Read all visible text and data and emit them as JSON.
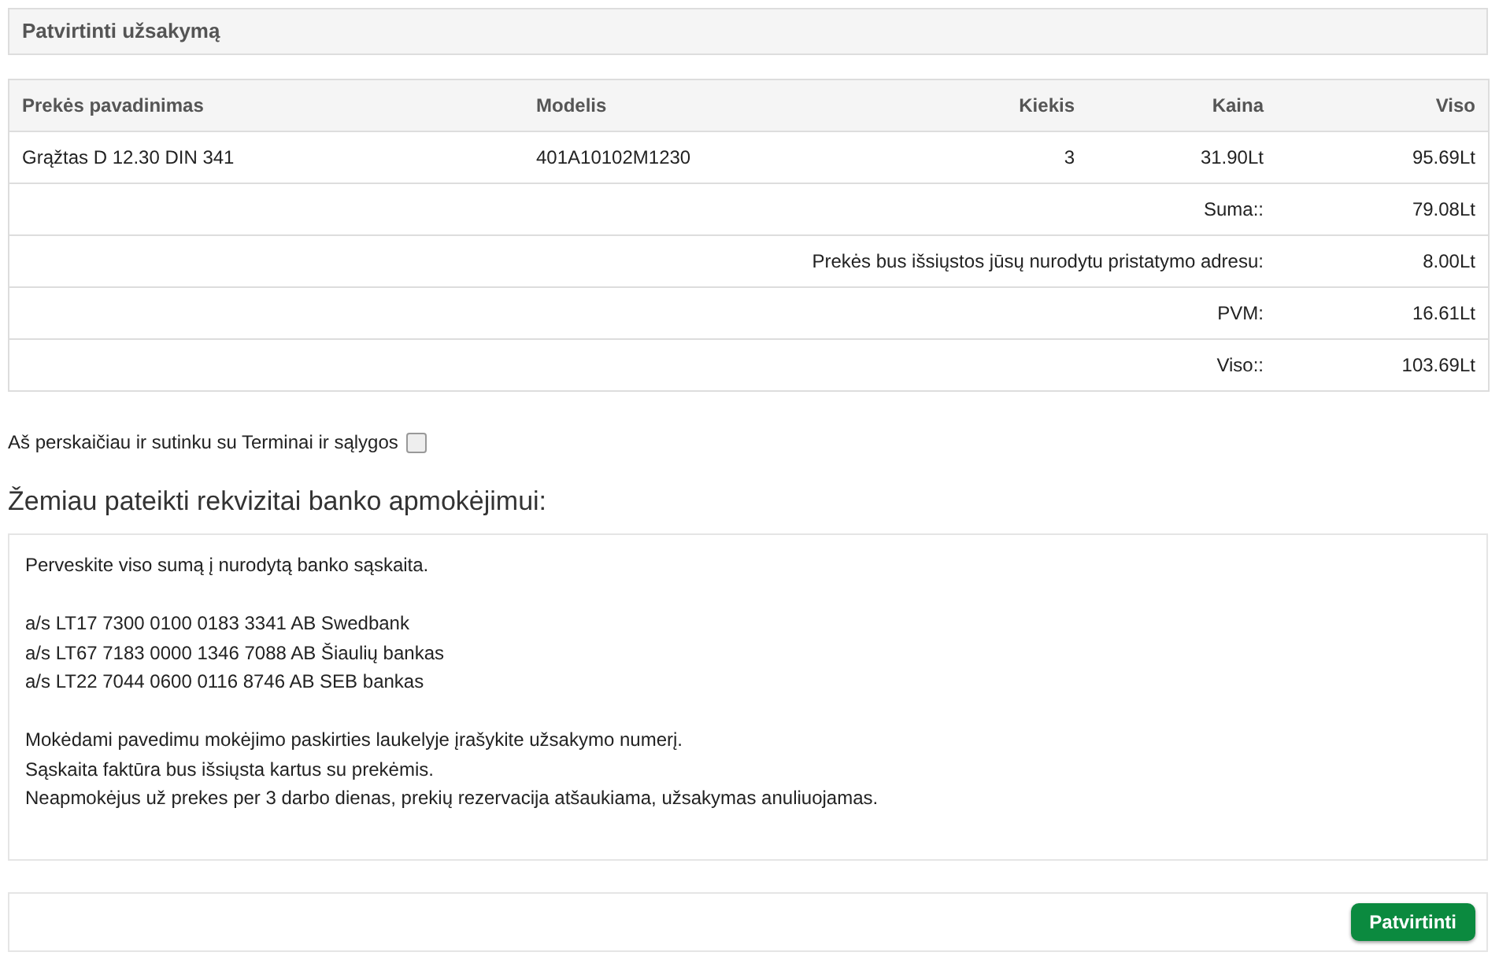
{
  "panel": {
    "title": "Patvirtinti užsakymą"
  },
  "table": {
    "columns": [
      "Prekės pavadinimas",
      "Modelis",
      "Kiekis",
      "Kaina",
      "Viso"
    ],
    "rows": [
      [
        "Grąžtas D 12.30 DIN 341",
        "401A10102M1230",
        "3",
        "31.90Lt",
        "95.69Lt"
      ]
    ],
    "totals": [
      {
        "label": "Suma::",
        "value": "79.08Lt"
      },
      {
        "label": "Prekės bus išsiųstos jūsų nurodytu pristatymo adresu:",
        "value": "8.00Lt"
      },
      {
        "label": "PVM:",
        "value": "16.61Lt"
      },
      {
        "label": "Viso::",
        "value": "103.69Lt"
      }
    ]
  },
  "agree": {
    "label": "Aš perskaičiau ir sutinku su Terminai ir sąlygos",
    "checked": false
  },
  "bank_heading": "Žemiau pateikti rekvizitai banko apmokėjimui:",
  "bank_info": [
    [
      "Perveskite viso sumą į nurodytą banko sąskaita."
    ],
    [
      "a/s LT17 7300 0100 0183 3341 AB Swedbank",
      "a/s LT67 7183 0000 1346 7088 AB Šiaulių bankas",
      "a/s LT22 7044 0600 0116 8746 AB SEB bankas"
    ],
    [
      "Mokėdami pavedimu mokėjimo paskirties laukelyje įrašykite užsakymo numerį.",
      "Sąskaita faktūra bus išsiųsta kartus su prekėmis.",
      "Neapmokėjus už prekes per 3 darbo dienas, prekių rezervacija atšaukiama, užsakymas anuliuojamas."
    ]
  ],
  "confirm_button": "Patvirtinti"
}
